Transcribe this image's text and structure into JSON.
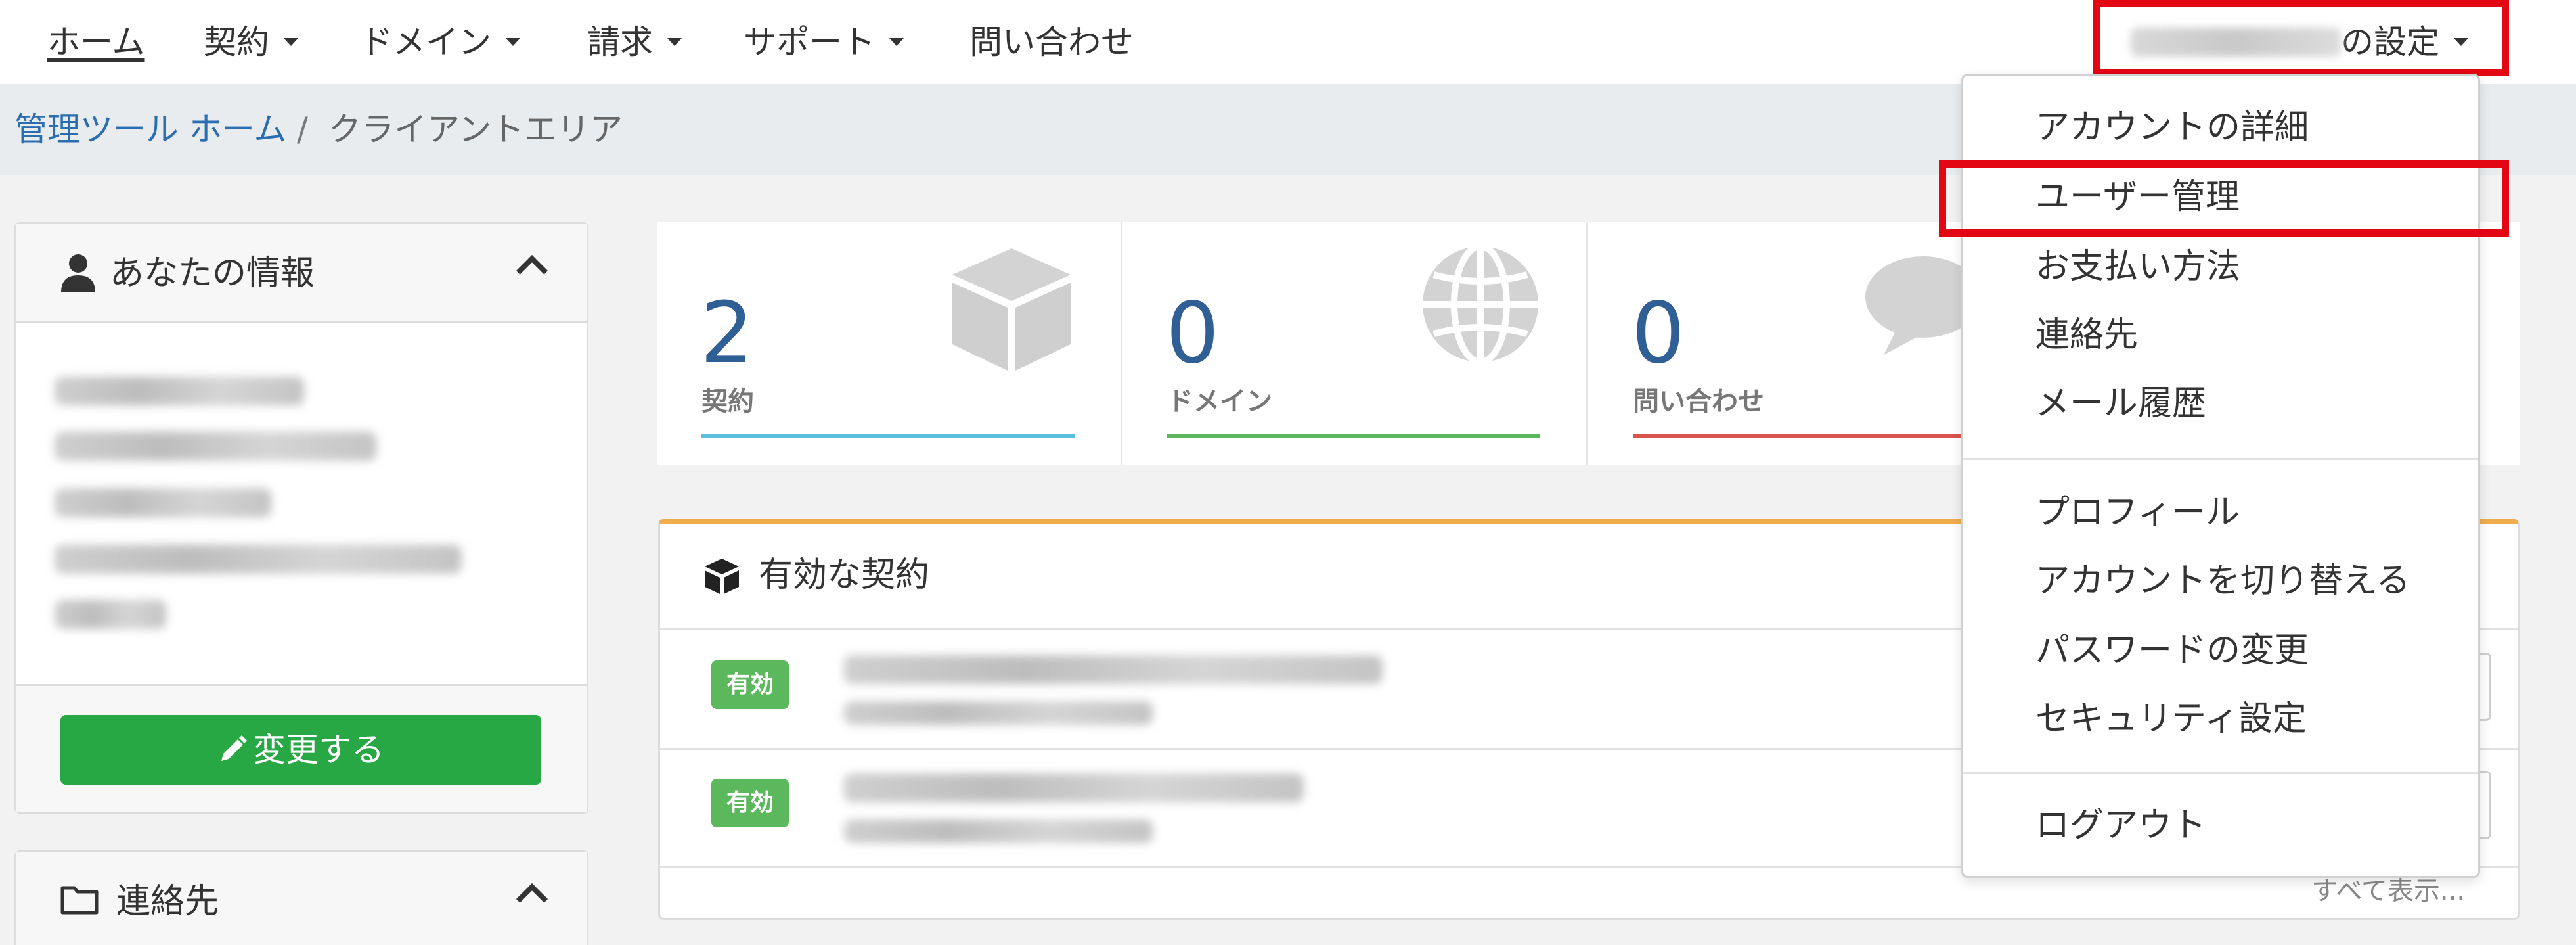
{
  "nav": {
    "items": [
      {
        "label": "ホーム",
        "dropdown": false,
        "active": true
      },
      {
        "label": "契約",
        "dropdown": true
      },
      {
        "label": "ドメイン",
        "dropdown": true
      },
      {
        "label": "請求",
        "dropdown": true
      },
      {
        "label": "サポート",
        "dropdown": true
      },
      {
        "label": "問い合わせ",
        "dropdown": false
      }
    ],
    "settings_suffix": "の設定"
  },
  "breadcrumb": {
    "home": "管理ツール ホーム",
    "separator": "/",
    "current": "クライアントエリア"
  },
  "sidebar": {
    "info_title": "あなたの情報",
    "edit_button": "変更する",
    "contacts_title": "連絡先"
  },
  "stats": [
    {
      "value": "2",
      "label": "契約",
      "color": "#5bc0de",
      "icon": "box-icon"
    },
    {
      "value": "0",
      "label": "ドメイン",
      "color": "#5cb85c",
      "icon": "globe-icon"
    },
    {
      "value": "0",
      "label": "問い合わせ",
      "color": "#d9534f",
      "icon": "chat-bubble-icon"
    }
  ],
  "contracts": {
    "title": "有効な契約",
    "rows": [
      {
        "status": "有効"
      },
      {
        "status": "有効"
      }
    ],
    "show_all": "すべて表示..."
  },
  "dropdown": {
    "items": [
      "アカウントの詳細",
      "ユーザー管理",
      "お支払い方法",
      "連絡先",
      "メール履歴",
      "プロフィール",
      "アカウントを切り替える",
      "パスワードの変更",
      "セキュリティ設定",
      "ログアウト"
    ]
  },
  "colors": {
    "highlight": "#e30613",
    "link": "#2a6db0",
    "success": "#28a745",
    "accent": "#f0ad4e"
  }
}
